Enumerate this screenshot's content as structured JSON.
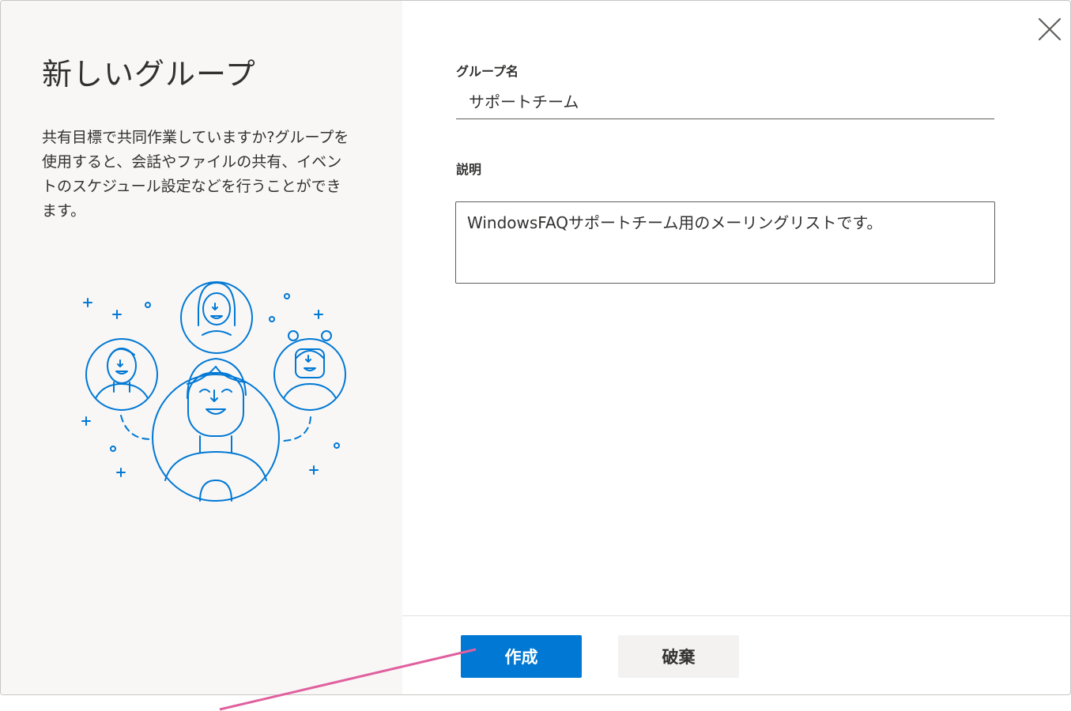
{
  "dialog": {
    "title": "新しいグループ",
    "description": "共有目標で共同作業していますか?グループを使用すると、会話やファイルの共有、イベントのスケジュール設定などを行うことができます。"
  },
  "form": {
    "group_name_label": "グループ名",
    "group_name_value": "サポートチーム",
    "description_label": "説明",
    "description_value": "WindowsFAQサポートチーム用のメーリングリストです。"
  },
  "actions": {
    "create_label": "作成",
    "discard_label": "破棄"
  },
  "icons": {
    "close": "close-icon",
    "illustration": "group-people-illustration"
  },
  "colors": {
    "primary": "#0078d4",
    "annotation_arrow": "#e0609e",
    "panel_bg": "#f8f7f6"
  }
}
